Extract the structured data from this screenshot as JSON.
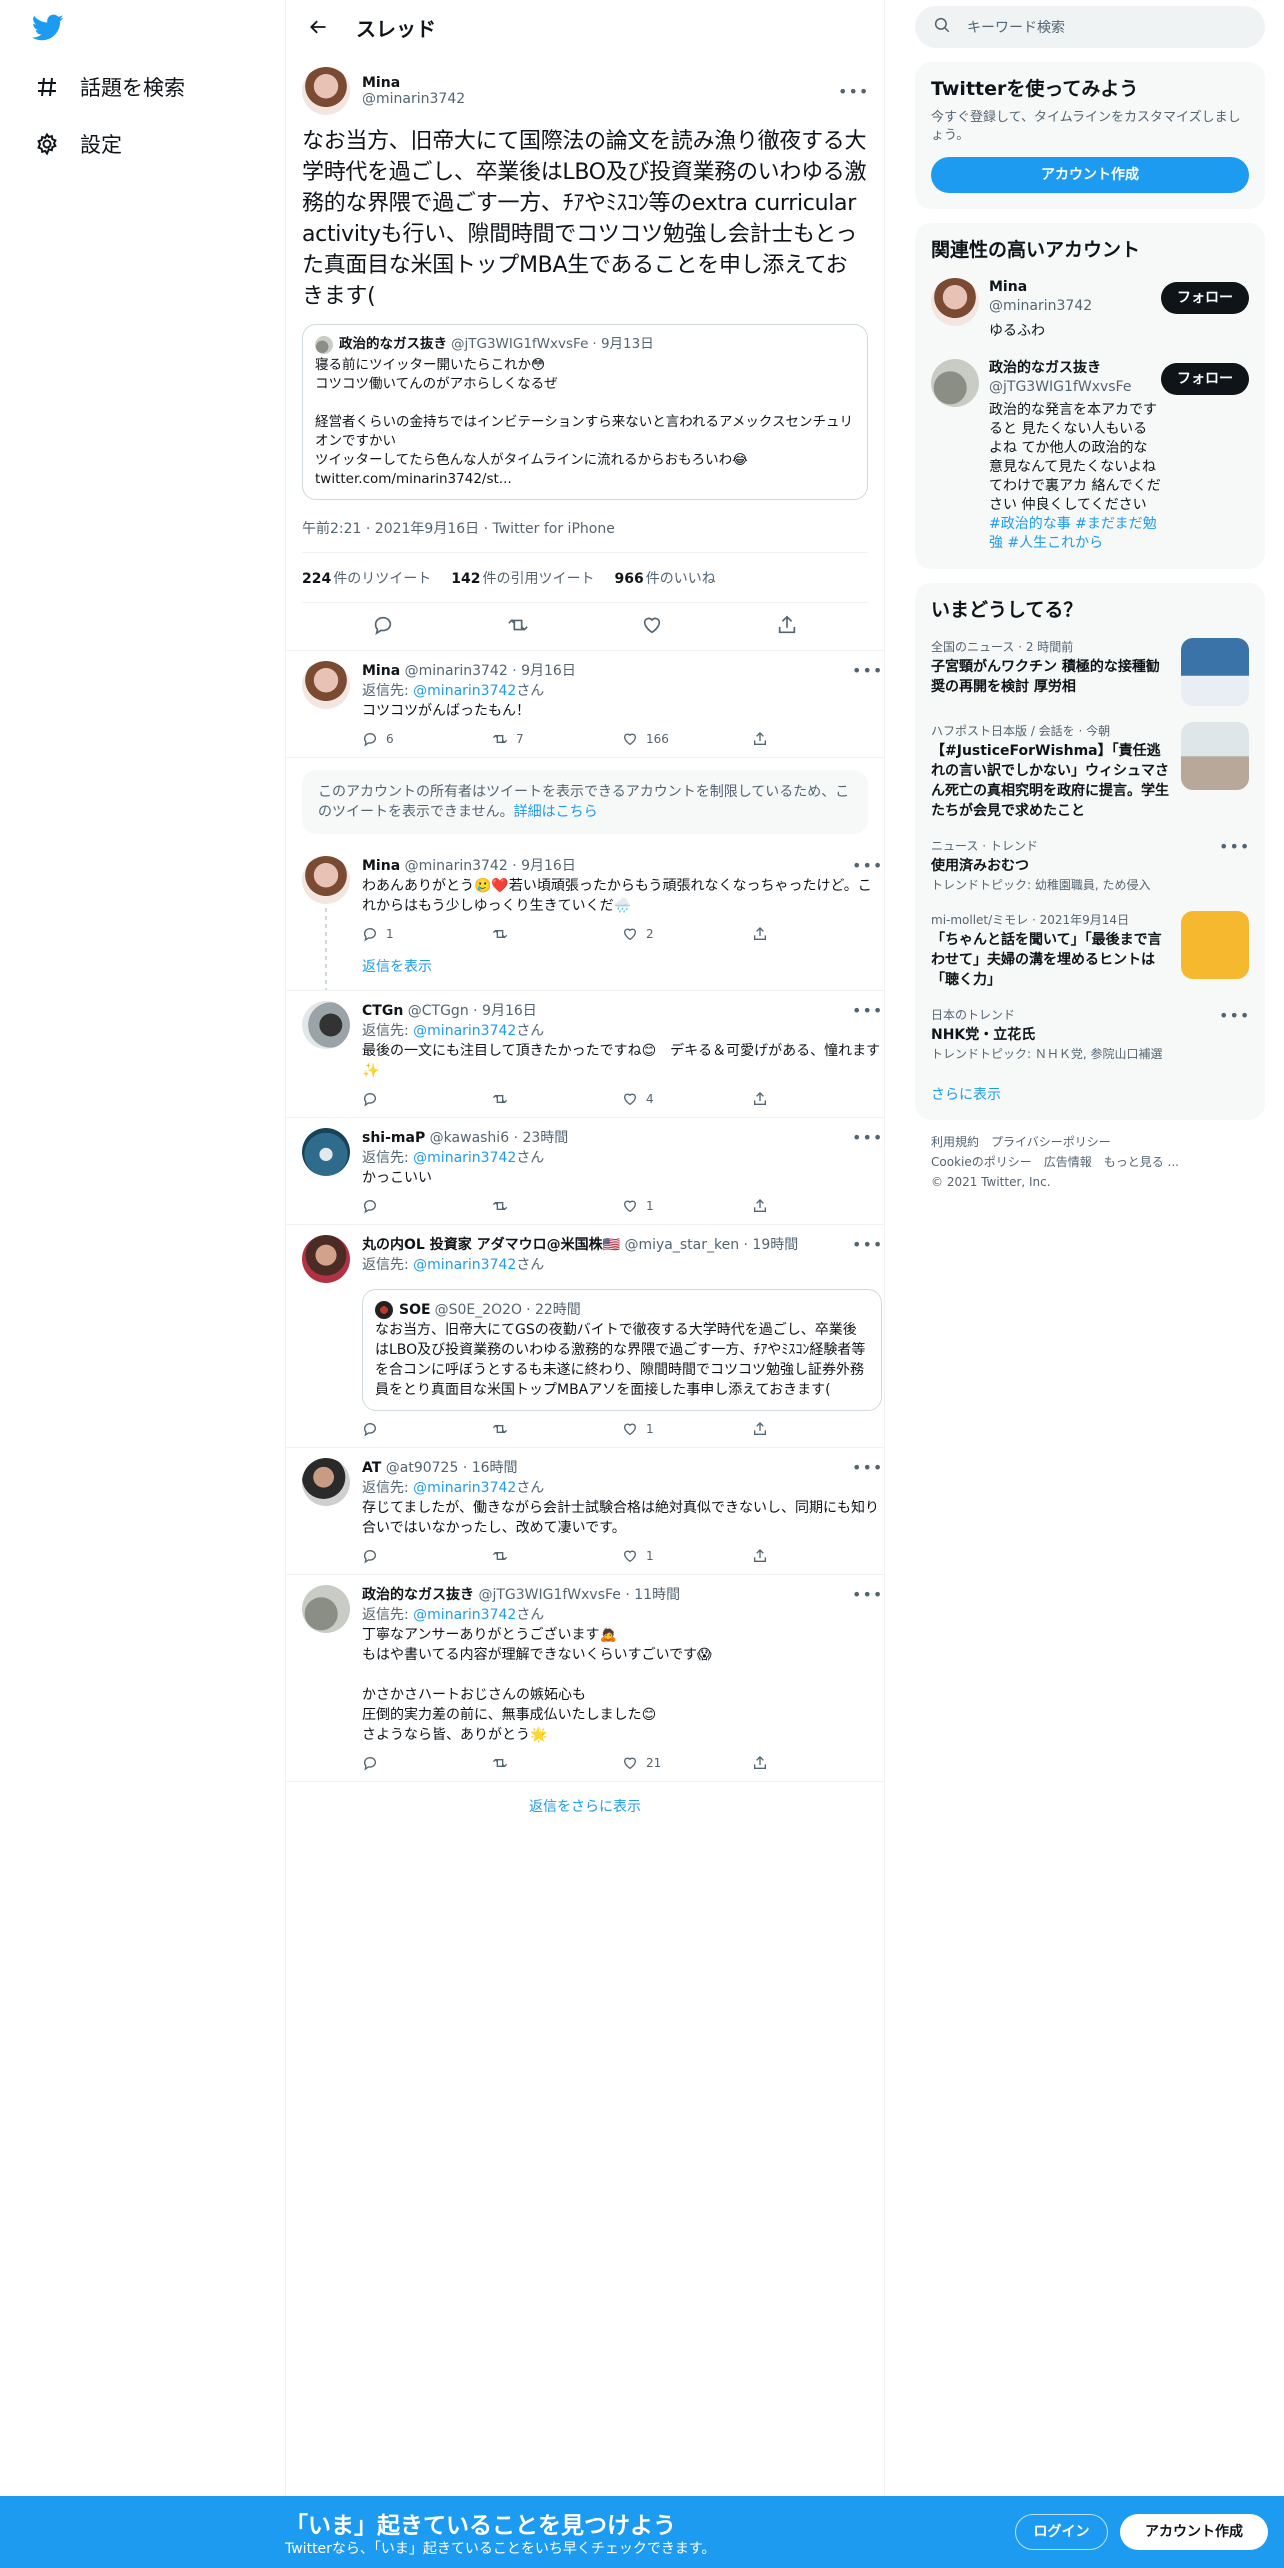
{
  "nav": {
    "explore_label": "話題を検索",
    "settings_label": "設定"
  },
  "header": {
    "title": "スレッド"
  },
  "main_tweet": {
    "name": "Mina",
    "handle": "@minarin3742",
    "text": "なお当方、旧帝大にて国際法の論文を読み漁り徹夜する大学時代を過ごし、卒業後はLBO及び投資業務のいわゆる激務的な界隈で過ごす一方、ﾁｱやﾐｽｺﾝ等のextra curricular activityも行い、隙間時間でコツコツ勉強し会計士もとった真面目な米国トップMBA生であることを申し添えておきます(",
    "quote": {
      "name": "政治的なガス抜き",
      "handle": "@jTG3WIG1fWxvsFe",
      "date": "· 9月13日",
      "line1": "寝る前にツイッター開いたらこれか😳",
      "line2": "コツコツ働いてんのがアホらしくなるぜ",
      "line3": "経営者くらいの金持ちではインビテーションすら来ないと言われるアメックスセンチュリオンですかい",
      "line4": "ツイッターしてたら色んな人がタイムラインに流れるからおもろいわ😂",
      "link": "twitter.com/minarin3742/st..."
    },
    "meta": "午前2:21 · 2021年9月16日 · Twitter for iPhone",
    "retweets": "224",
    "retweets_label": "件のリツイート",
    "quotes": "142",
    "quotes_label": "件の引用ツイート",
    "likes": "966",
    "likes_label": "件のいいね"
  },
  "replies": [
    {
      "name": "Mina",
      "handle": "@minarin3742",
      "time": "· 9月16日",
      "reply_prefix": "返信先: ",
      "reply_to": "@minarin3742",
      "reply_suffix": "さん",
      "text": "コツコツがんばったもん！",
      "reply_count": "6",
      "retweet_count": "7",
      "like_count": "166"
    },
    {
      "name": "Mina",
      "handle": "@minarin3742",
      "time": "· 9月16日",
      "text": "わあんありがとう🥲❤️若い頃頑張ったからもう頑張れなくなっちゃったけど。これからはもう少しゆっくり生きていくだ🌧️",
      "reply_count": "1",
      "retweet_count": "",
      "like_count": "2",
      "show_replies": "返信を表示"
    },
    {
      "name": "CTGn",
      "handle": "@CTGgn",
      "time": "· 9月16日",
      "reply_prefix": "返信先: ",
      "reply_to": "@minarin3742",
      "reply_suffix": "さん",
      "text": "最後の一文にも注目して頂きたかったですね😊　デキる＆可愛げがある、憧れます✨",
      "reply_count": "",
      "retweet_count": "",
      "like_count": "4"
    },
    {
      "name": "shi-maP",
      "handle": "@kawashi6",
      "time": "· 23時間",
      "reply_prefix": "返信先: ",
      "reply_to": "@minarin3742",
      "reply_suffix": "さん",
      "text": "かっこいい",
      "reply_count": "",
      "retweet_count": "",
      "like_count": "1"
    },
    {
      "name": "丸の内OL 投資家 アダマウロ@米国株🇺🇸",
      "handle": "@miya_star_ken",
      "time": "· 19時間",
      "reply_prefix": "返信先: ",
      "reply_to": "@minarin3742",
      "reply_suffix": "さん",
      "quote_name": "SOE",
      "quote_handle": "@S0E_2O2O",
      "quote_time": "· 22時間",
      "quote_text": "なお当方、旧帝大にてGSの夜勤バイトで徹夜する大学時代を過ごし、卒業後はLBO及び投資業務のいわゆる激務的な界隈で過ごす一方、ﾁｱやﾐｽｺﾝ経験者等を合コンに呼ぼうとするも未遂に終わり、隙間時間でコツコツ勉強し証券外務員をとり真面目な米国トップMBAアソを面接した事申し添えておきます(",
      "reply_count": "",
      "retweet_count": "",
      "like_count": "1"
    },
    {
      "name": "AT",
      "handle": "@at90725",
      "time": "· 16時間",
      "reply_prefix": "返信先: ",
      "reply_to": "@minarin3742",
      "reply_suffix": "さん",
      "text": "存じてましたが、働きながら会計士試験合格は絶対真似できないし、同期にも知り合いではいなかったし、改めて凄いです。",
      "reply_count": "",
      "retweet_count": "",
      "like_count": "1"
    },
    {
      "name": "政治的なガス抜き",
      "handle": "@jTG3WIG1fWxvsFe",
      "time": "· 11時間",
      "reply_prefix": "返信先: ",
      "reply_to": "@minarin3742",
      "reply_suffix": "さん",
      "line1": "丁寧なアンサーありがとうございます🙇",
      "line2": "もはや書いてる内容が理解できないくらいすごいです😱",
      "line3": "かさかさハートおじさんの嫉妬心も",
      "line4": "圧倒的実力差の前に、無事成仏いたしました😊",
      "line5": "さようなら皆、ありがとう🌟",
      "reply_count": "",
      "retweet_count": "",
      "like_count": "21"
    }
  ],
  "restricted": {
    "text": "このアカウントの所有者はツイートを表示できるアカウントを制限しているため、このツイートを表示できません。",
    "link": "詳細はこちら"
  },
  "more_replies": "返信をさらに表示",
  "search": {
    "placeholder": "キーワード検索"
  },
  "signup_card": {
    "title": "Twitterを使ってみよう",
    "sub": "今すぐ登録して、タイムラインをカスタマイズしましょう。",
    "button": "アカウント作成"
  },
  "related": {
    "title": "関連性の高いアカウント",
    "accounts": [
      {
        "name": "Mina",
        "handle": "@minarin3742",
        "bio": "ゆるふわ",
        "follow": "フォロー"
      },
      {
        "name": "政治的なガス抜き",
        "handle": "@jTG3WIG1fWxvsFe",
        "bio": "政治的な発言を本アカですると 見たくない人もいるよね てか他人の政治的な意見なんて見たくないよね てわけで裏アカ 絡んでください 仲良くしてください ",
        "tags": "#政治的な事 #まだまだ勉強 #人生これから",
        "follow": "フォロー"
      }
    ]
  },
  "trends": {
    "title": "いまどうしてる？",
    "items": [
      {
        "meta": "全国のニュース · 2 時間前",
        "title": "子宮頸がんワクチン 積極的な接種勧奨の再開を検討 厚労相"
      },
      {
        "meta": "ハフポスト日本版 / 会話を · 今朝",
        "title": "【#JusticeForWishma】「責任逃れの言い訳でしかない」ウィシュマさん死亡の真相究明を政府に提言。学生たちが会見で求めたこと"
      },
      {
        "meta": "ニュース · トレンド",
        "title": "使用済みおむつ",
        "sub": "トレンドトピック: 幼稚園職員, ため侵入"
      },
      {
        "meta": "mi-mollet/ミモレ · 2021年9月14日",
        "title": "「ちゃんと話を聞いて」「最後まで言わせて」夫婦の溝を埋めるヒントは「聴く力」"
      },
      {
        "meta": "日本のトレンド",
        "title": "NHK党・立花氏",
        "sub": "トレンドトピック: ＮＨＫ党, 参院山口補選"
      }
    ],
    "more": "さらに表示"
  },
  "footer": {
    "line1": "利用規約　プライバシーポリシー",
    "line2": "Cookieのポリシー　広告情報　もっと見る ...",
    "line3": "© 2021 Twitter, Inc."
  },
  "bottom_bar": {
    "title": "「いま」起きていることを見つけよう",
    "sub": "Twitterなら、「いま」起きていることをいち早くチェックできます。",
    "login": "ログイン",
    "signup": "アカウント作成"
  },
  "colors": {
    "accent": "#1d9bf0",
    "text": "#0f1419",
    "muted": "#536471"
  }
}
